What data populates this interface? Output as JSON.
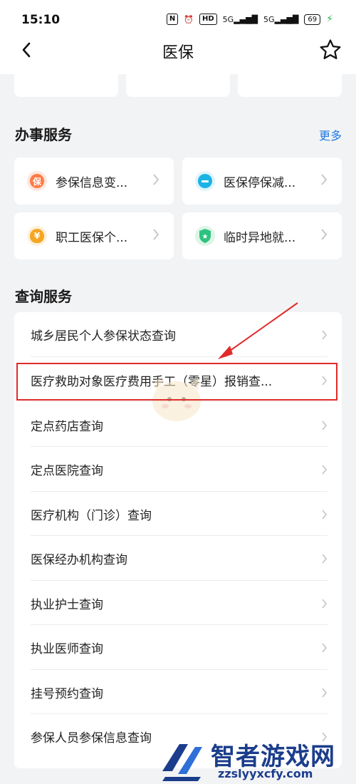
{
  "status": {
    "time": "15:10",
    "hd": "HD",
    "net1": "5G",
    "net2": "5G",
    "battery": "69"
  },
  "header": {
    "title": "医保"
  },
  "services": {
    "title": "办事服务",
    "more": "更多",
    "tiles": [
      {
        "label": "参保信息变...",
        "icon_char": "保",
        "icon_color": "#ff7a45",
        "icon_bg": "#fde7dc"
      },
      {
        "label": "医保停保减...",
        "icon_char": "−",
        "icon_color": "#1ab3e6",
        "icon_bg": "#dff4fb"
      },
      {
        "label": "职工医保个...",
        "icon_char": "¥",
        "icon_color": "#f5a623",
        "icon_bg": "#fdf1da"
      },
      {
        "label": "临时异地就...",
        "icon_char": "★",
        "icon_color": "#2ec27e",
        "icon_bg": "#ddf5e8"
      }
    ]
  },
  "query": {
    "title": "查询服务",
    "items": [
      {
        "label": "城乡居民个人参保状态查询"
      },
      {
        "label": "医疗救助对象医疗费用手工（零星）报销查..."
      },
      {
        "label": "定点药店查询"
      },
      {
        "label": "定点医院查询"
      },
      {
        "label": "医疗机构（门诊）查询"
      },
      {
        "label": "医保经办机构查询"
      },
      {
        "label": "执业护士查询"
      },
      {
        "label": "执业医师查询"
      },
      {
        "label": "挂号预约查询"
      },
      {
        "label": "参保人员参保信息查询"
      }
    ]
  },
  "watermark": {
    "name": "智者游戏网",
    "url": "zzslyyxcfy.com"
  },
  "colors": {
    "accent": "#1f7ae0",
    "highlight": "#e02b2b",
    "background": "#f2f3f5"
  }
}
